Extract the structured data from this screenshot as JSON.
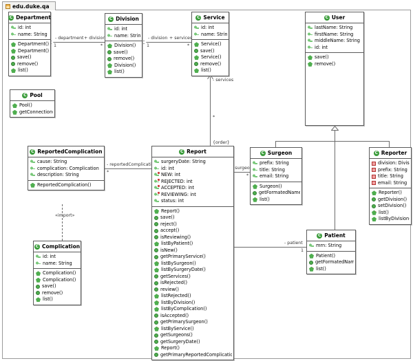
{
  "package": {
    "label": "edu.duke.qa",
    "icon": "package-icon"
  },
  "classes": [
    {
      "id": "department",
      "name": "Department",
      "attributes": [
        {
          "text": "id: int",
          "icon": "attribute-icon"
        },
        {
          "text": "name: String",
          "icon": "attribute-icon"
        }
      ],
      "methods": [
        {
          "text": "Department()",
          "icon": "constructor-icon"
        },
        {
          "text": "Department()",
          "icon": "constructor-icon"
        },
        {
          "text": "save()",
          "icon": "method-icon"
        },
        {
          "text": "remove()",
          "icon": "method-icon"
        },
        {
          "text": "list()",
          "icon": "static-method-icon"
        }
      ]
    },
    {
      "id": "division",
      "name": "Division",
      "attributes": [
        {
          "text": "id: int",
          "icon": "attribute-icon"
        },
        {
          "text": "name: String",
          "icon": "attribute-icon"
        }
      ],
      "methods": [
        {
          "text": "Division()",
          "icon": "constructor-icon"
        },
        {
          "text": "save()",
          "icon": "method-icon"
        },
        {
          "text": "remove()",
          "icon": "method-icon"
        },
        {
          "text": "Division()",
          "icon": "constructor-icon"
        },
        {
          "text": "list()",
          "icon": "static-method-icon"
        }
      ]
    },
    {
      "id": "service",
      "name": "Service",
      "attributes": [
        {
          "text": "id: int",
          "icon": "attribute-icon"
        },
        {
          "text": "name: String",
          "icon": "attribute-icon"
        }
      ],
      "methods": [
        {
          "text": "Service()",
          "icon": "constructor-icon"
        },
        {
          "text": "save()",
          "icon": "method-icon"
        },
        {
          "text": "Service()",
          "icon": "constructor-icon"
        },
        {
          "text": "remove()",
          "icon": "method-icon"
        },
        {
          "text": "list()",
          "icon": "static-method-icon"
        }
      ]
    },
    {
      "id": "user",
      "name": "User",
      "attributes": [
        {
          "text": "lastName: String",
          "icon": "attribute-icon"
        },
        {
          "text": "firstName: String",
          "icon": "attribute-icon"
        },
        {
          "text": "middleName: String",
          "icon": "attribute-icon"
        },
        {
          "text": "id: int",
          "icon": "attribute-icon"
        }
      ],
      "methods": [
        {
          "text": "save()",
          "icon": "constructor-icon"
        },
        {
          "text": "remove()",
          "icon": "constructor-icon"
        }
      ]
    },
    {
      "id": "pool",
      "name": "Pool",
      "attributes": [],
      "methods": [
        {
          "text": "Pool()",
          "icon": "constructor-icon"
        },
        {
          "text": "getConnection()",
          "icon": "constructor-icon"
        }
      ]
    },
    {
      "id": "reportedcomplication",
      "name": "ReportedComplication",
      "attributes": [
        {
          "text": "cause: String",
          "icon": "attribute-icon"
        },
        {
          "text": "complication: Complication",
          "icon": "attribute-icon"
        },
        {
          "text": "description: String",
          "icon": "attribute-icon"
        }
      ],
      "methods": [
        {
          "text": "ReportedComplication()",
          "icon": "constructor-icon"
        }
      ]
    },
    {
      "id": "complication",
      "name": "Complication",
      "attributes": [
        {
          "text": "id: int",
          "icon": "attribute-icon"
        },
        {
          "text": "name: String",
          "icon": "attribute-icon"
        }
      ],
      "methods": [
        {
          "text": "Complication()",
          "icon": "constructor-icon"
        },
        {
          "text": "Complication()",
          "icon": "constructor-icon"
        },
        {
          "text": "save()",
          "icon": "method-icon"
        },
        {
          "text": "remove()",
          "icon": "method-icon"
        },
        {
          "text": "list()",
          "icon": "static-method-icon"
        }
      ]
    },
    {
      "id": "report",
      "name": "Report",
      "attributes": [
        {
          "text": "surgeryDate: String",
          "icon": "attribute-icon"
        },
        {
          "text": "id: int",
          "icon": "attribute-icon"
        },
        {
          "text": "NEW: int",
          "icon": "static-attribute-icon"
        },
        {
          "text": "REJECTED: int",
          "icon": "static-attribute-icon"
        },
        {
          "text": "ACCEPTED: int",
          "icon": "static-attribute-icon"
        },
        {
          "text": "REVIEWING: int",
          "icon": "static-attribute-icon"
        },
        {
          "text": "status: int",
          "icon": "attribute-icon"
        }
      ],
      "methods": [
        {
          "text": "Report()",
          "icon": "constructor-icon"
        },
        {
          "text": "save()",
          "icon": "method-icon"
        },
        {
          "text": "reject()",
          "icon": "method-icon"
        },
        {
          "text": "accept()",
          "icon": "method-icon"
        },
        {
          "text": "isReviewing()",
          "icon": "method-icon"
        },
        {
          "text": "listByPatient()",
          "icon": "static-method-icon"
        },
        {
          "text": "isNew()",
          "icon": "method-icon"
        },
        {
          "text": "getPrimaryService()",
          "icon": "method-icon"
        },
        {
          "text": "listBySurgeon()",
          "icon": "static-method-icon"
        },
        {
          "text": "listBySurgeryDate()",
          "icon": "static-method-icon"
        },
        {
          "text": "getServices()",
          "icon": "method-icon"
        },
        {
          "text": "isRejected()",
          "icon": "method-icon"
        },
        {
          "text": "review()",
          "icon": "method-icon"
        },
        {
          "text": "listRejected()",
          "icon": "static-method-icon"
        },
        {
          "text": "listByDivision()",
          "icon": "static-method-icon"
        },
        {
          "text": "listByComplication()",
          "icon": "static-method-icon"
        },
        {
          "text": "isAccepted()",
          "icon": "method-icon"
        },
        {
          "text": "getPrimarySurgeon()",
          "icon": "method-icon"
        },
        {
          "text": "listByService()",
          "icon": "static-method-icon"
        },
        {
          "text": "getSurgeons()",
          "icon": "method-icon"
        },
        {
          "text": "getSurgeryDate()",
          "icon": "method-icon"
        },
        {
          "text": "Report()",
          "icon": "constructor-icon"
        },
        {
          "text": "getPrimaryReportedComplication()",
          "icon": "method-icon"
        }
      ]
    },
    {
      "id": "surgeon",
      "name": "Surgeon",
      "attributes": [
        {
          "text": "prefix: String",
          "icon": "attribute-icon"
        },
        {
          "text": "title: String",
          "icon": "attribute-icon"
        },
        {
          "text": "email: String",
          "icon": "attribute-icon"
        }
      ],
      "methods": [
        {
          "text": "Surgeon()",
          "icon": "constructor-icon"
        },
        {
          "text": "getFormatedName()",
          "icon": "method-icon"
        },
        {
          "text": "list()",
          "icon": "static-method-icon"
        }
      ]
    },
    {
      "id": "reporter",
      "name": "Reporter",
      "attributes": [
        {
          "text": "division: Division",
          "icon": "private-attribute-icon"
        },
        {
          "text": "prefix: String",
          "icon": "private-attribute-icon"
        },
        {
          "text": "title: String",
          "icon": "private-attribute-icon"
        },
        {
          "text": "email: String",
          "icon": "private-attribute-icon"
        }
      ],
      "methods": [
        {
          "text": "Reporter()",
          "icon": "constructor-icon"
        },
        {
          "text": "getDivision()",
          "icon": "method-icon"
        },
        {
          "text": "setDivision()",
          "icon": "method-icon"
        },
        {
          "text": "list()",
          "icon": "static-method-icon"
        },
        {
          "text": "listByDivision()",
          "icon": "static-method-icon"
        }
      ]
    },
    {
      "id": "patient",
      "name": "Patient",
      "attributes": [
        {
          "text": "mrn: String",
          "icon": "attribute-icon"
        }
      ],
      "methods": [
        {
          "text": "Patient()",
          "icon": "constructor-icon"
        },
        {
          "text": "getFormatedName()",
          "icon": "method-icon"
        },
        {
          "text": "list()",
          "icon": "static-method-icon"
        }
      ]
    }
  ],
  "relations": {
    "dept_div_src_role": "- department",
    "dept_div_src_mult": "1",
    "dept_div_tgt_role": "+ divisions",
    "dept_div_tgt_mult": "*",
    "div_svc_src_role": "- division",
    "div_svc_src_mult": "1",
    "div_svc_tgt_role": "+ services",
    "div_svc_tgt_mult": "*",
    "svc_report_role": "- services",
    "svc_report_mult": "*",
    "svc_report_constraint": "{order}",
    "report_surgeon_role": "- surgeons",
    "report_surgeon_mult": "*",
    "report_rc_role": "- reportedComplications",
    "report_rc_mult": "*",
    "report_patient_role": "- patient",
    "report_patient_mult": "1",
    "rc_complication_stereotype": "«import»"
  }
}
